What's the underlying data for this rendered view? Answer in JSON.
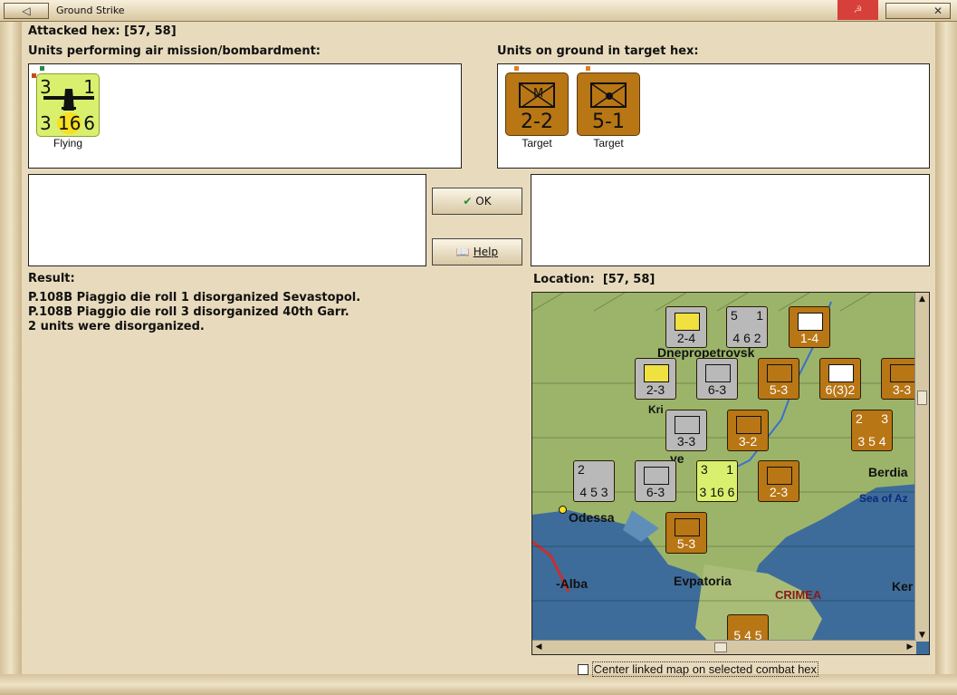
{
  "window": {
    "title": "Ground Strike"
  },
  "header": {
    "attacked_hex_label": "Attacked hex:",
    "attacked_hex_value": "[57, 58]"
  },
  "air_panel": {
    "label": "Units performing air mission/bombardment:",
    "units": [
      {
        "top_left": "3",
        "top_right": "1",
        "bottom_left": "3",
        "center": "16",
        "bottom_right": "6",
        "caption": "Flying",
        "color": "#d8f06e",
        "icon": "bomber-icon"
      }
    ]
  },
  "ground_panel": {
    "label": "Units on ground in target hex:",
    "units": [
      {
        "type_label": "M",
        "value": "2-2",
        "caption": "Target",
        "color": "#b87615",
        "icon": "motorized-infantry-icon"
      },
      {
        "value": "5-1",
        "caption": "Target",
        "color": "#b87615",
        "icon": "garrison-infantry-icon"
      }
    ]
  },
  "buttons": {
    "ok": "OK",
    "help": "Help"
  },
  "result": {
    "label": "Result:",
    "lines": [
      "P.108B Piaggio die roll 1 disorganized Sevastopol.",
      "P.108B Piaggio die roll 3 disorganized 40th Garr.",
      "2 units were disorganized."
    ]
  },
  "location": {
    "label": "Location:",
    "value": "[57, 58]"
  },
  "map": {
    "places": [
      "Dnepropetrovsk",
      "Kri",
      "Berdia",
      "Sea of Az",
      "Odessa",
      "Evpatoria",
      "CRIMEA",
      "-Alba",
      "Ker",
      "ye"
    ],
    "counters": [
      {
        "v": "2-4",
        "c": "gray"
      },
      {
        "v": "4 6 2",
        "c": "gray",
        "top": "5",
        "tr": "1"
      },
      {
        "v": "1-4",
        "c": "brown"
      },
      {
        "v": "2-3",
        "c": "gray"
      },
      {
        "v": "6-3",
        "c": "gray"
      },
      {
        "v": "5-3",
        "c": "brown"
      },
      {
        "v": "6(3)2",
        "c": "brown"
      },
      {
        "v": "3-3",
        "c": "brown"
      },
      {
        "v": "3-3",
        "c": "gray"
      },
      {
        "v": "3-2",
        "c": "brown"
      },
      {
        "v": "3 5 4",
        "c": "brown",
        "top": "2",
        "tr": "3"
      },
      {
        "v": "4 5 3",
        "c": "gray",
        "top": "2"
      },
      {
        "v": "6-3",
        "c": "gray"
      },
      {
        "v": "3 16 6",
        "c": "yg",
        "top": "3",
        "tr": "1"
      },
      {
        "v": "2-3",
        "c": "brown"
      },
      {
        "v": "5-3",
        "c": "brown"
      },
      {
        "v": "5 4 5",
        "c": "brown"
      }
    ],
    "stack_numbers": [
      "3",
      "3",
      "2",
      "3",
      "2",
      "2",
      "2",
      "3",
      "5"
    ]
  },
  "checkbox": {
    "label": "Center linked map on selected combat hex",
    "checked": false
  }
}
